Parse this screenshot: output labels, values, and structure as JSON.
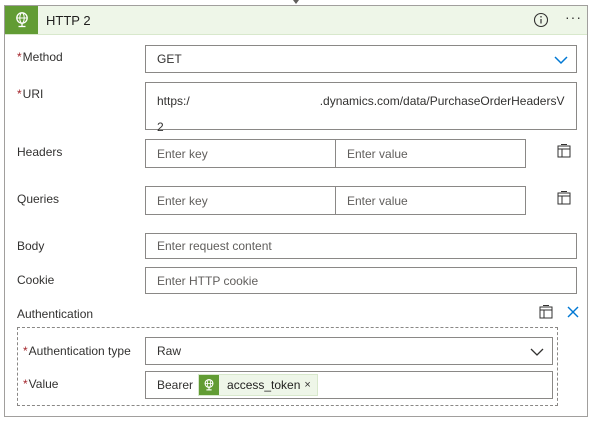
{
  "header": {
    "title": "HTTP 2",
    "icon": "globe-icon",
    "accent_color": "#629c34"
  },
  "method": {
    "label": "Method",
    "required_marker": "*",
    "value": "GET"
  },
  "uri": {
    "label": "URI",
    "required_marker": "*",
    "line1_start": "https:/",
    "line1_end": ".dynamics.com/data/PurchaseOrderHeadersV",
    "line2": "2"
  },
  "headers": {
    "label": "Headers",
    "key_placeholder": "Enter key",
    "value_placeholder": "Enter value"
  },
  "queries": {
    "label": "Queries",
    "key_placeholder": "Enter key",
    "value_placeholder": "Enter value"
  },
  "body": {
    "label": "Body",
    "placeholder": "Enter request content"
  },
  "cookie": {
    "label": "Cookie",
    "placeholder": "Enter HTTP cookie"
  },
  "authentication": {
    "label": "Authentication",
    "type_label": "Authentication type",
    "type_required_marker": "*",
    "type_value": "Raw",
    "value_label": "Value",
    "value_required_marker": "*",
    "value_prefix": "Bearer",
    "token_name": "access_token",
    "token_remove": "×"
  }
}
